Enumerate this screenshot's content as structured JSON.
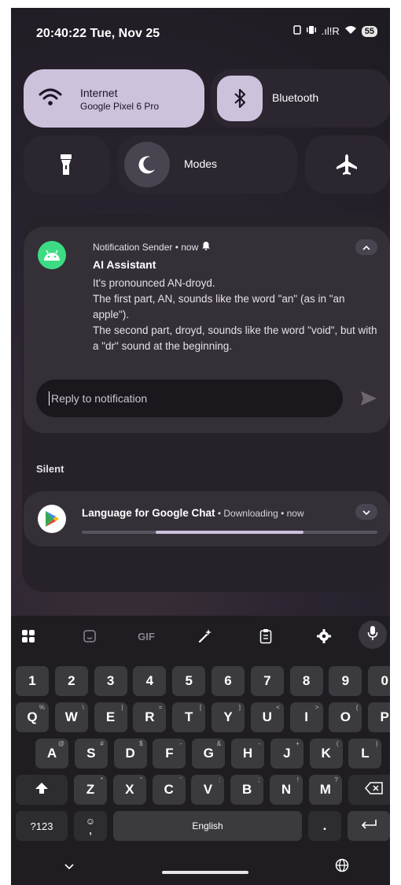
{
  "status_bar": {
    "time": "20:40:22",
    "date": "Tue, Nov 25",
    "signal_text": ".ıl!R",
    "battery": "55"
  },
  "quick_settings": {
    "internet": {
      "label": "Internet",
      "sub": "Google Pixel 6 Pro"
    },
    "bluetooth": {
      "label": "Bluetooth"
    },
    "modes": {
      "label": "Modes"
    }
  },
  "notification": {
    "sender": "Notification Sender • now",
    "title": "AI Assistant",
    "lines": [
      "It's pronounced AN-droyd.",
      "The first part, AN, sounds like the word \"an\" (as in \"an apple\").",
      "The second part, droyd, sounds like the word \"void\", but with a \"dr\" sound at the beginning."
    ],
    "reply_placeholder": "Reply to notification"
  },
  "silent_section": {
    "header": "Silent",
    "item": {
      "app": "Language for Google Chat",
      "meta": " • Downloading • now",
      "progress": 0.5
    }
  },
  "keyboard": {
    "toolbar": {
      "gif": "GIF"
    },
    "row_numbers": [
      "1",
      "2",
      "3",
      "4",
      "5",
      "6",
      "7",
      "8",
      "9",
      "0"
    ],
    "row_q": [
      "Q",
      "W",
      "E",
      "R",
      "T",
      "Y",
      "U",
      "I",
      "O",
      "P"
    ],
    "row_q_hints": [
      "%",
      "\\",
      "|",
      "=",
      "[",
      "]",
      "<",
      ">",
      "{",
      "}"
    ],
    "row_a": [
      "A",
      "S",
      "D",
      "F",
      "G",
      "H",
      "J",
      "K",
      "L"
    ],
    "row_a_hints": [
      "@",
      "#",
      "$",
      "-",
      "&",
      "-",
      "+",
      "(",
      ")"
    ],
    "row_z": [
      "Z",
      "X",
      "C",
      "V",
      "B",
      "N",
      "M"
    ],
    "row_z_hints": [
      "*",
      "\"",
      "'",
      ":",
      ";",
      "!",
      "?"
    ],
    "symbols_key": "?123",
    "emoji_comma": ",",
    "space_label": "English",
    "period": "."
  },
  "colors": {
    "accent": "#ccc2dc",
    "android_green": "#3ddc84"
  }
}
